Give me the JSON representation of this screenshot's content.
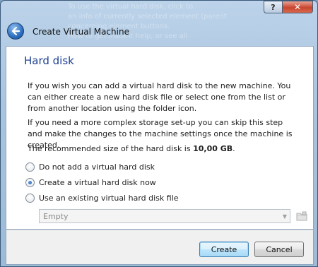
{
  "window": {
    "background_text": [
      "To use the virtual hard disk, click to",
      "an info of currently selected element (parent",
      "concerning element buttons.",
      "",
      "How to get instant help, or see all"
    ],
    "help_label": "?",
    "close_label": "✕"
  },
  "wizard": {
    "title": "Create Virtual Machine"
  },
  "page": {
    "title": "Hard disk",
    "paragraph1": "If you wish you can add a virtual hard disk to the new machine. You can either create a new hard disk file or select one from the list or from another location using the folder icon.",
    "paragraph2": "If you need a more complex storage set-up you can skip this step and make the changes to the machine settings once the machine is created.",
    "recommended_prefix": "The recommended size of the hard disk is ",
    "recommended_size": "10,00 GB",
    "recommended_suffix": ".",
    "options": [
      {
        "label": "Do not add a virtual hard disk",
        "selected": false
      },
      {
        "label": "Create a virtual hard disk now",
        "selected": true
      },
      {
        "label": "Use an existing virtual hard disk file",
        "selected": false
      }
    ],
    "existing_disk_select": {
      "value": "Empty",
      "enabled": false
    }
  },
  "buttons": {
    "create": "Create",
    "cancel": "Cancel"
  },
  "colors": {
    "title_blue": "#1c3f94",
    "close_red": "#c8452f"
  }
}
